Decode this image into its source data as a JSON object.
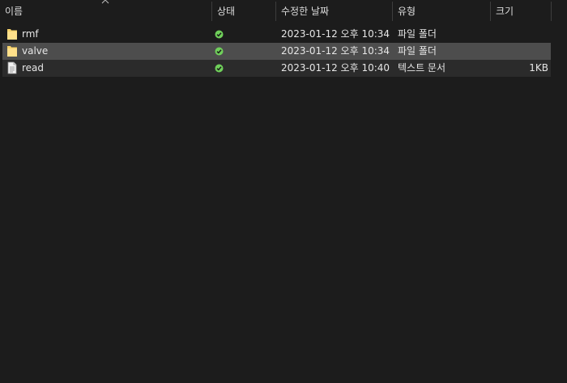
{
  "columns": {
    "name": "이름",
    "status": "상태",
    "modified": "수정한 날짜",
    "type": "유형",
    "size": "크기"
  },
  "sort_icon": "chevron-up-icon",
  "files": [
    {
      "name": "rmf",
      "icon": "folder-icon",
      "status_icon": "sync-ok-icon",
      "modified": "2023-01-12 오후 10:34",
      "type": "파일 폴더",
      "size": ""
    },
    {
      "name": "valve",
      "icon": "folder-icon",
      "status_icon": "sync-ok-icon",
      "modified": "2023-01-12 오후 10:34",
      "type": "파일 폴더",
      "size": ""
    },
    {
      "name": "read",
      "icon": "text-document-icon",
      "status_icon": "sync-ok-icon",
      "modified": "2023-01-12 오후 10:40",
      "type": "텍스트 문서",
      "size": "1KB"
    }
  ],
  "colors": {
    "background": "#1c1c1c",
    "selected_row": "#4d4d4d",
    "hover_row": "#2b2b2b",
    "folder": "#f7d36b",
    "status_ok": "#6fcf5a"
  }
}
